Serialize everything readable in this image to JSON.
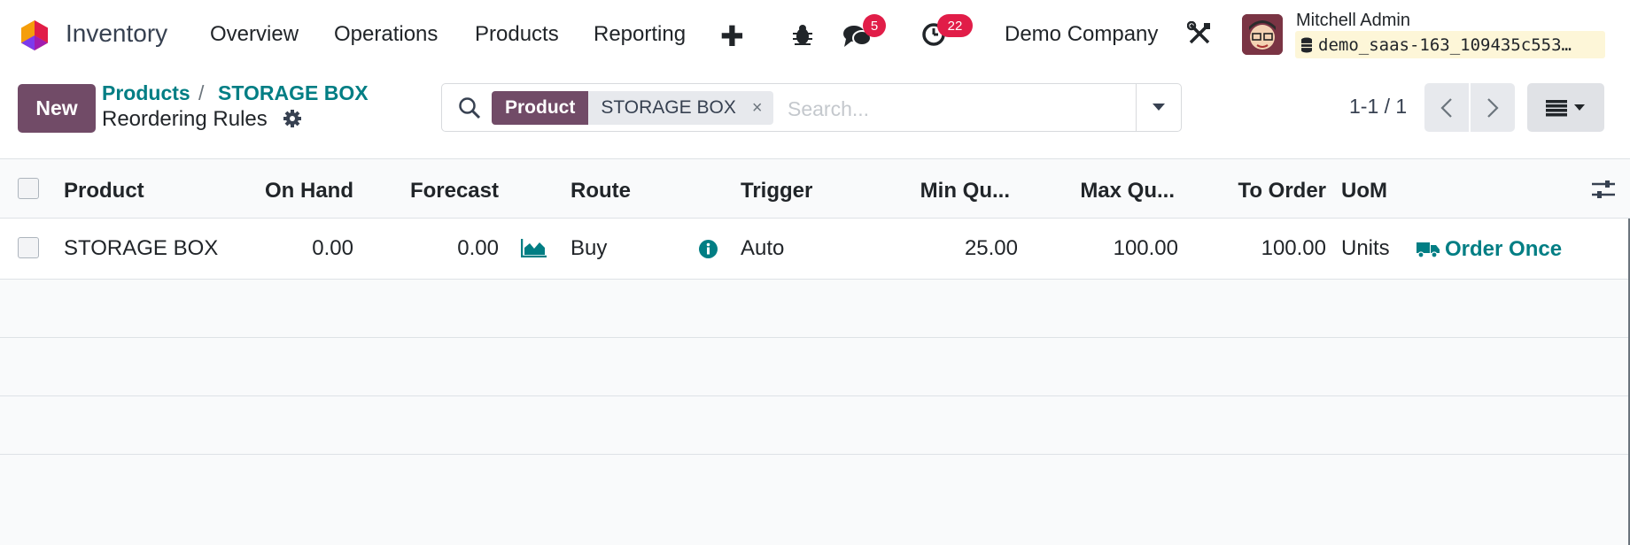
{
  "navbar": {
    "app_name": "Inventory",
    "menu": [
      "Overview",
      "Operations",
      "Products",
      "Reporting"
    ],
    "plus_label": "✚",
    "messages_count": "5",
    "activities_count": "22",
    "company": "Demo Company",
    "user_name": "Mitchell Admin",
    "database": "demo_saas-163_109435c553…"
  },
  "control_panel": {
    "new_label": "New",
    "breadcrumb": [
      "Products",
      "STORAGE BOX"
    ],
    "breadcrumb_sep": "/",
    "title": "Reordering Rules",
    "search": {
      "facet_label": "Product",
      "facet_value": "STORAGE BOX",
      "facet_close": "×",
      "placeholder": "Search..."
    },
    "pager": "1-1 / 1"
  },
  "table": {
    "headers": {
      "product": "Product",
      "on_hand": "On Hand",
      "forecast": "Forecast",
      "route": "Route",
      "trigger": "Trigger",
      "min_qty": "Min Qu...",
      "max_qty": "Max Qu...",
      "to_order": "To Order",
      "uom": "UoM"
    },
    "rows": [
      {
        "product": "STORAGE BOX",
        "on_hand": "0.00",
        "forecast": "0.00",
        "route": "Buy",
        "trigger": "Auto",
        "min_qty": "25.00",
        "max_qty": "100.00",
        "to_order": "100.00",
        "uom": "Units",
        "action": "Order Once"
      }
    ]
  },
  "colors": {
    "brand": "#714b67",
    "link": "#017e84",
    "badge": "#e11d48"
  },
  "icons": [
    "app-logo-icon",
    "bug-icon",
    "chat-icon",
    "clock-icon",
    "tools-icon",
    "database-icon",
    "gear-icon",
    "search-icon",
    "caret-down-icon",
    "chevron-left-icon",
    "chevron-right-icon",
    "list-view-icon",
    "forecast-chart-icon",
    "info-icon",
    "truck-icon",
    "column-settings-icon"
  ]
}
